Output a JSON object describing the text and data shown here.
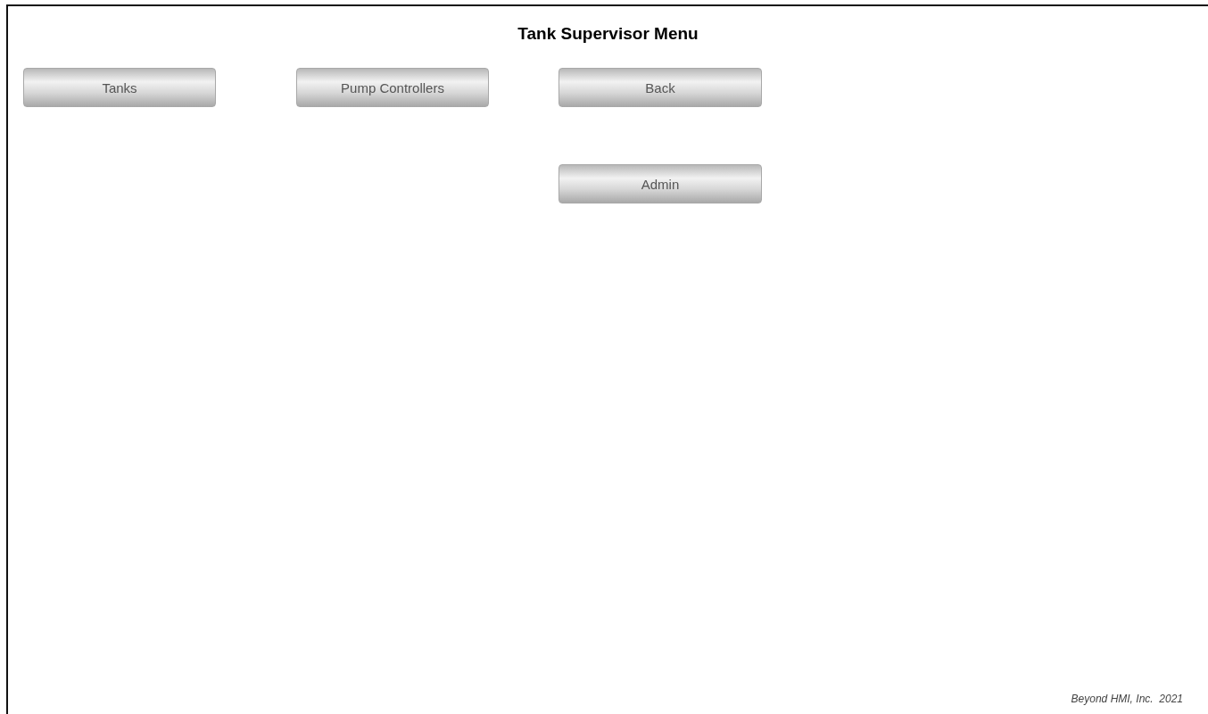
{
  "title": "Tank Supervisor Menu",
  "button_rows": [
    {
      "buttons": [
        "Tanks",
        "Pump Controllers",
        "Back"
      ]
    },
    {
      "buttons": [
        "Admin"
      ]
    }
  ],
  "footer": "Beyond HMI, Inc.  2021"
}
